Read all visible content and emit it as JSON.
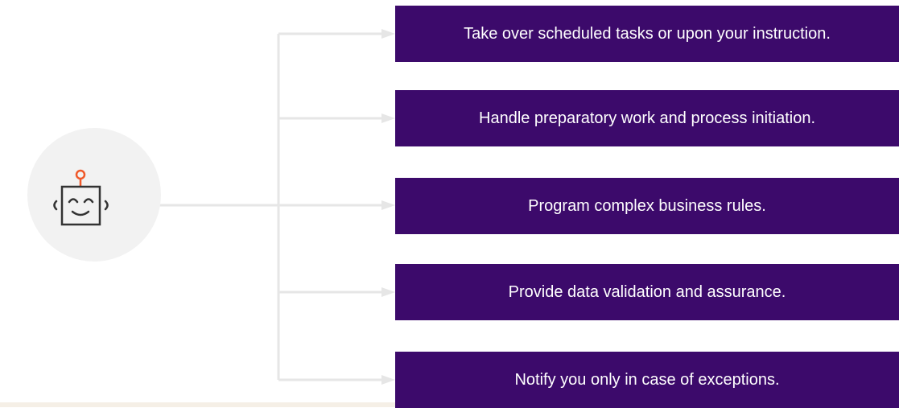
{
  "colors": {
    "box_background": "#3c0a6b",
    "box_text": "#ffffff",
    "connector": "#e6e6e6",
    "robot_circle": "#f2f2f2",
    "robot_outline": "#333333",
    "robot_antenna": "#f0592a"
  },
  "robot": {
    "icon": "robot-icon"
  },
  "items": [
    {
      "label": "Take over scheduled tasks or upon your instruction."
    },
    {
      "label": "Handle preparatory work and process initiation."
    },
    {
      "label": "Program complex business rules."
    },
    {
      "label": "Provide data validation and assurance."
    },
    {
      "label": "Notify you only in case of exceptions."
    }
  ]
}
